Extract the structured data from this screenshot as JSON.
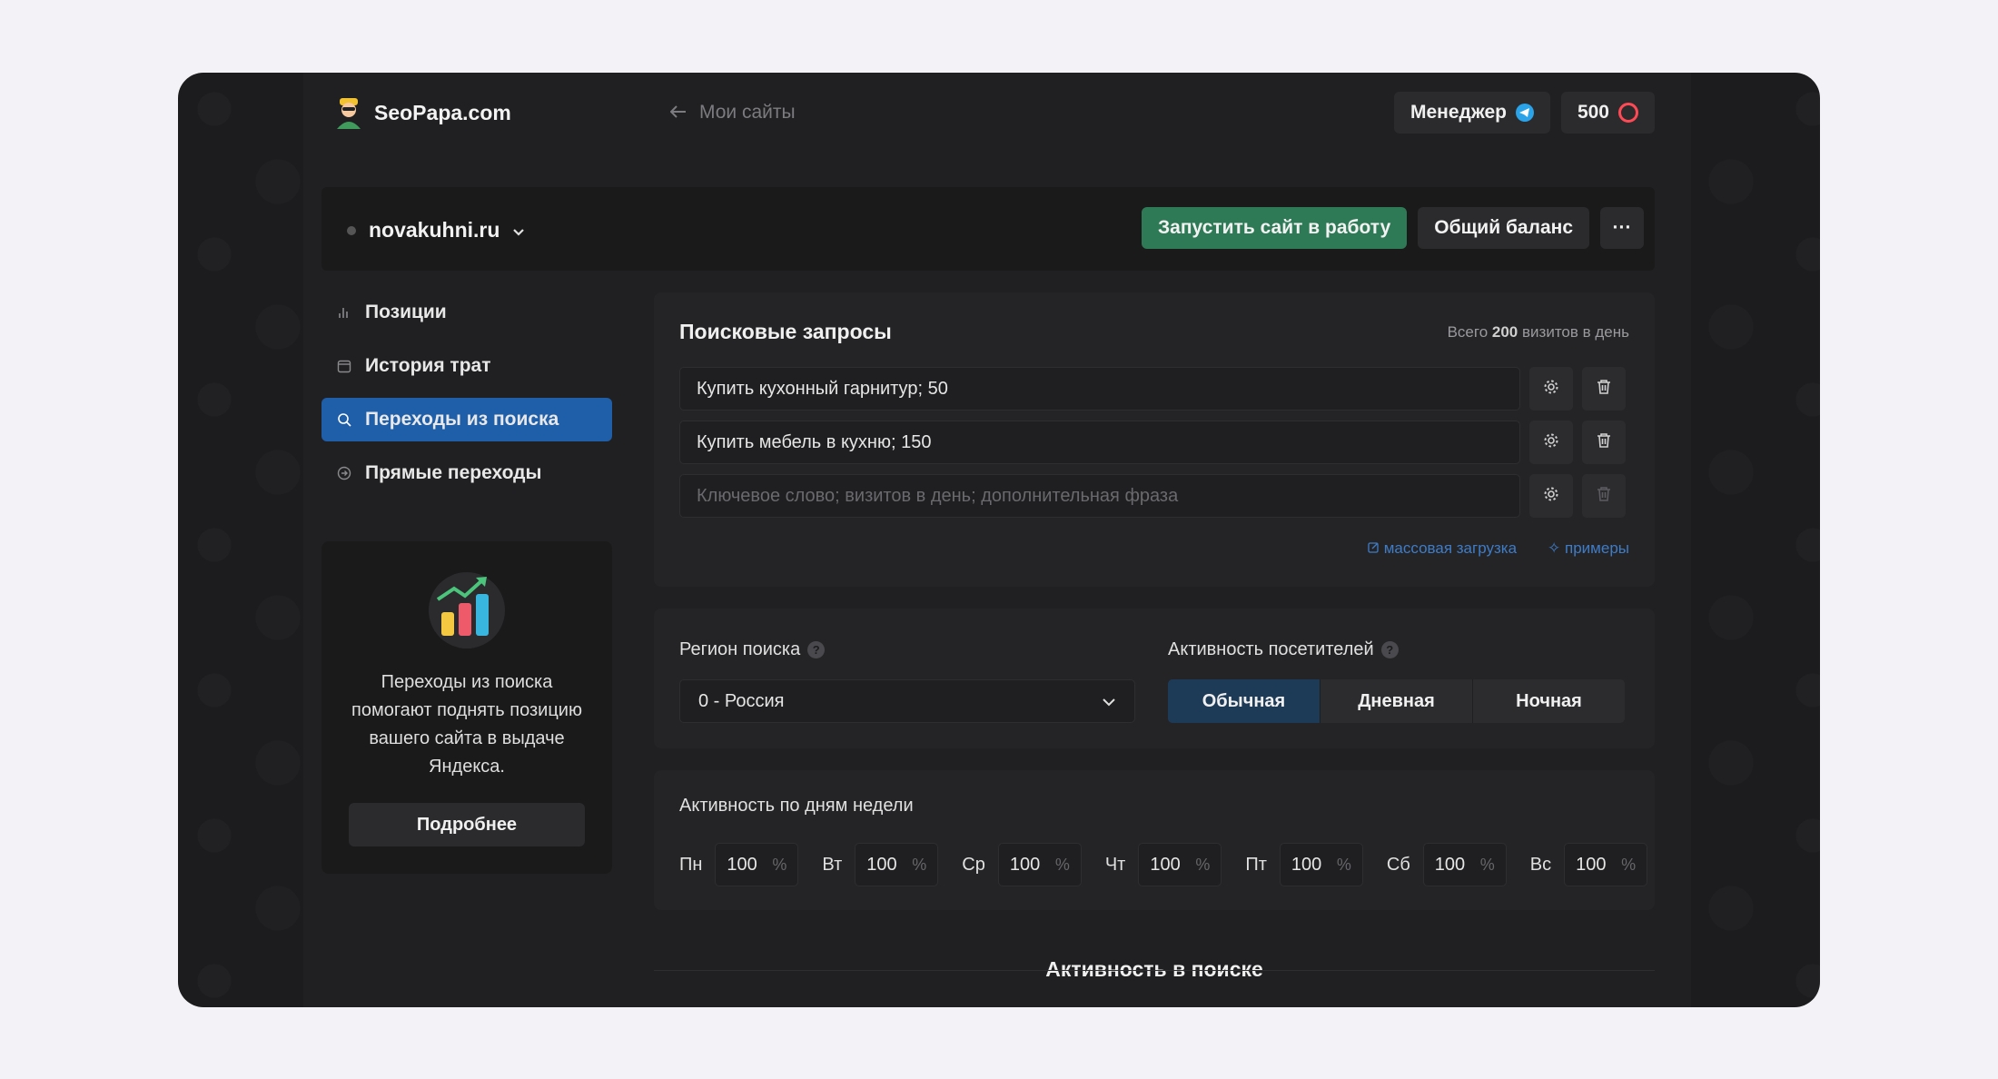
{
  "logo": {
    "text": "SeoPapa.com"
  },
  "nav_back": {
    "label": "Мои сайты"
  },
  "top_right": {
    "manager_label": "Менеджер",
    "balance_value": "500"
  },
  "site": {
    "name": "novakuhni.ru",
    "start_button": "Запустить сайт в работу",
    "balance_button": "Общий баланс",
    "more_button": "···"
  },
  "sidebar": {
    "items": [
      {
        "label": "Позиции",
        "icon": "bar-chart-icon",
        "active": false
      },
      {
        "label": "История трат",
        "icon": "calendar-icon",
        "active": false
      },
      {
        "label": "Переходы из поиска",
        "icon": "search-icon",
        "active": true
      },
      {
        "label": "Прямые переходы",
        "icon": "arrow-circle-icon",
        "active": false
      }
    ],
    "promo": {
      "text": "Переходы из поиска помогают поднять позицию вашего сайта в выдаче Яндекса.",
      "button": "Подробнее"
    }
  },
  "queries": {
    "title": "Поисковые запросы",
    "meta_prefix": "Всего",
    "meta_total": "200",
    "meta_suffix": "визитов в день",
    "rows": [
      {
        "value": "Купить кухонный гарнитур; 50"
      },
      {
        "value": "Купить мебель в кухню; 150"
      }
    ],
    "placeholder": "Ключевое слово; визитов в день; дополнительная фраза",
    "bulk_upload": "массовая загрузка",
    "examples": "примеры"
  },
  "region": {
    "label": "Регион поиска",
    "selected": "0 - Россия"
  },
  "activity": {
    "label": "Активность посетителей",
    "options": [
      "Обычная",
      "Дневная",
      "Ночная"
    ],
    "selected_index": 0
  },
  "weekdays": {
    "title": "Активность по дням недели",
    "unit": "%",
    "days": [
      {
        "label": "Пн",
        "value": "100"
      },
      {
        "label": "Вт",
        "value": "100"
      },
      {
        "label": "Ср",
        "value": "100"
      },
      {
        "label": "Чт",
        "value": "100"
      },
      {
        "label": "Пт",
        "value": "100"
      },
      {
        "label": "Сб",
        "value": "100"
      },
      {
        "label": "Вс",
        "value": "100"
      }
    ]
  },
  "search_activity": {
    "title": "Активность в поиске"
  },
  "colors": {
    "accent_blue": "#1f5ea8",
    "accent_green": "#2f7a56",
    "coin_red": "#ff4a55",
    "telegram": "#2aa3e8"
  }
}
